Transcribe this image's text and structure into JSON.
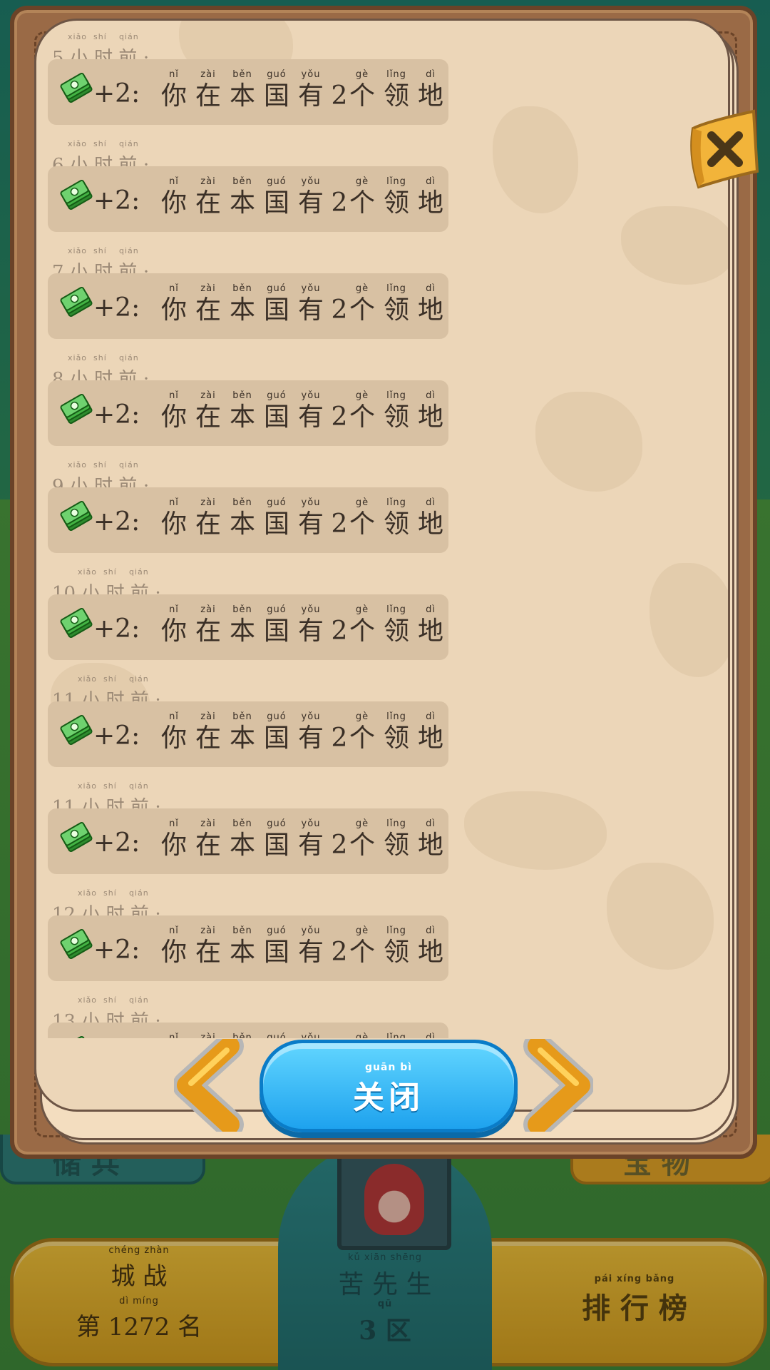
{
  "background": {
    "left_tab_label": "储 兵",
    "right_tab_label": "宝 物",
    "city_battle": {
      "title_pinyin": "chéng  zhàn",
      "title": "城 战",
      "rank_pinyin": "dì         míng",
      "rank": "第 1272 名"
    },
    "player": {
      "name_pinyin": "kǔ  xiān  shēng",
      "name": "苦 先 生",
      "server_pinyin": "qū",
      "server": "3 区"
    },
    "leaderboard": {
      "pinyin": "pái  xíng  bǎng",
      "label": "排 行 榜"
    }
  },
  "log": {
    "time_pinyin": [
      "xiǎo",
      "shí",
      "qián"
    ],
    "time_suffix": "小 时 前 :",
    "reward_text": "+2:",
    "message_pinyin": [
      "nǐ",
      "zài",
      "běn",
      "guó",
      "yǒu",
      "",
      "gè",
      "lǐng",
      "dì"
    ],
    "message_chars": [
      "你",
      "在",
      "本",
      "国",
      "有",
      "2",
      "个",
      "领",
      "地"
    ],
    "entries": [
      {
        "hours": "5"
      },
      {
        "hours": "6"
      },
      {
        "hours": "7"
      },
      {
        "hours": "8"
      },
      {
        "hours": "9"
      },
      {
        "hours": "10"
      },
      {
        "hours": "11"
      },
      {
        "hours": "11"
      },
      {
        "hours": "12"
      },
      {
        "hours": "13"
      }
    ]
  },
  "buttons": {
    "close_pinyin": "guān   bì",
    "close_label": "关闭"
  },
  "colors": {
    "close_button": "#1ea2ee",
    "arrow": "#f5a623",
    "paper": "#ecd6b8",
    "frame": "#9a6a46"
  }
}
